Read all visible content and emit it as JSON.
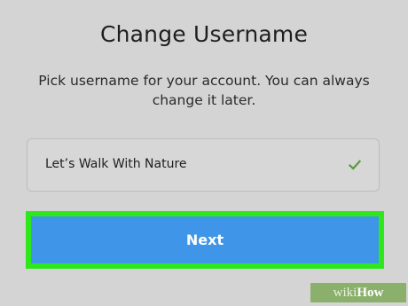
{
  "screen": {
    "title": "Change Username",
    "description": "Pick username for your account. You can always change it later."
  },
  "username_field": {
    "value": "Let’s Walk With Nature",
    "status_icon": "check-icon",
    "status_color": "#5a9a3a"
  },
  "next_button": {
    "label": "Next",
    "color": "#3f96e8",
    "highlight_color": "#2ee81c"
  },
  "watermark": {
    "prefix": "wiki",
    "suffix": "How",
    "color": "#8bb06b"
  }
}
